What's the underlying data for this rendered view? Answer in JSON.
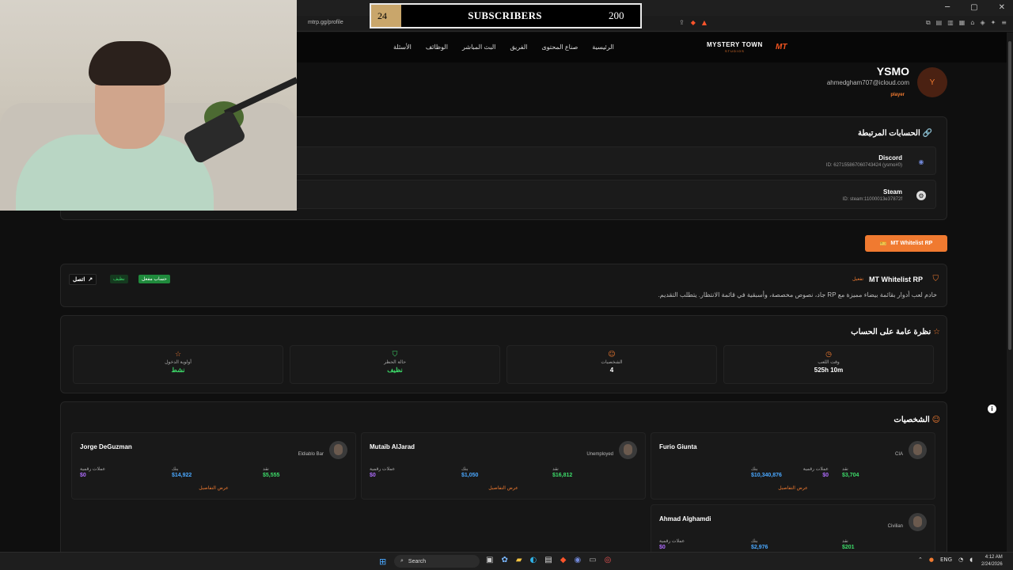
{
  "browser": {
    "url": "mtrp.gg/profile",
    "window_controls": [
      "─",
      "▢",
      "✕"
    ]
  },
  "overlay": {
    "subs_current": "24",
    "subs_label": "SUBSCRIBERS",
    "subs_goal": "200"
  },
  "nav": {
    "links": [
      "الأسئلة",
      "الوظائف",
      "البث المباشر",
      "الفريق",
      "صناع المحتوى",
      "الرئيسية"
    ],
    "logo_main": "MYSTERY TOWN",
    "logo_sub": "STUDIOS",
    "logo_mark": "MT"
  },
  "profile": {
    "avatar_letter": "Y",
    "name": "YSMO",
    "email": "ahmedgham707@icloud.com",
    "role": "player"
  },
  "linked": {
    "title": "الحسابات المرتبطة",
    "accounts": [
      {
        "name": "Discord",
        "id": "ID: 627155867060743424 (ysmo#0)"
      },
      {
        "name": "Steam",
        "id": "ID: steam:11000013e37872f"
      }
    ]
  },
  "server_button": "MT Whitelist RP",
  "server": {
    "name": "MT Whitelist RP",
    "tag": "تفعيل",
    "description": "خادم لعب أدوار بقائمة بيضاء مميزة مع RP جاد، نصوص مخصصة، وأسبقية في قائمة الانتظار. يتطلب التقديم.",
    "badge_active": "حساب مفعل",
    "badge_clean": "نظيف",
    "connect": "اتصل"
  },
  "overview": {
    "title": "نظرة عامة على الحساب",
    "stats": [
      {
        "label": "وقت اللعب",
        "value": "525h 10m",
        "color": "#ffffff"
      },
      {
        "label": "الشخصيات",
        "value": "4",
        "color": "#ffffff"
      },
      {
        "label": "حالة الحظر",
        "value": "نظيف",
        "color": "#3ddc6a"
      },
      {
        "label": "أولوية الدخول",
        "value": "نشط",
        "color": "#3ddc6a"
      }
    ]
  },
  "characters": {
    "title": "الشخصيات",
    "labels": {
      "cash": "نقد",
      "bank": "بنك",
      "crypto": "عملات رقمية",
      "details": "عرض التفاصيل"
    },
    "list": [
      {
        "name": "Furio Giunta",
        "job": "CIA",
        "cash": "$3,704",
        "bank": "$10,340,876",
        "crypto": "$0"
      },
      {
        "name": "Mutaib AlJarad",
        "job": "Unemployed",
        "cash": "$16,812",
        "bank": "$1,050",
        "crypto": "$0"
      },
      {
        "name": "Jorge DeGuzman",
        "job": "Eldiablo Bar",
        "cash": "$5,555",
        "bank": "$14,922",
        "crypto": "$0"
      },
      {
        "name": "Ahmad Alghamdi",
        "job": "Civilian",
        "cash": "$201",
        "bank": "$2,976",
        "crypto": "$0"
      }
    ]
  },
  "taskbar": {
    "search": "Search",
    "lang": "ENG",
    "time": "4:12 AM",
    "date": "2/24/2026"
  }
}
